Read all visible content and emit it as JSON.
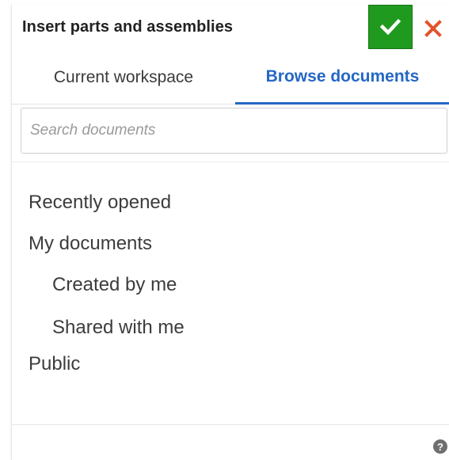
{
  "dialog": {
    "title": "Insert parts and assemblies",
    "accept_icon": "check-icon",
    "cancel_icon": "close-icon",
    "accept_color": "#1f9a1f",
    "cancel_color": "#e4532a"
  },
  "tabs": [
    {
      "label": "Current workspace",
      "active": false
    },
    {
      "label": "Browse documents",
      "active": true
    }
  ],
  "active_tab_color": "#2568c4",
  "search": {
    "value": "",
    "placeholder": "Search documents"
  },
  "nav": {
    "items": [
      {
        "label": "Recently opened",
        "level": 0
      },
      {
        "label": "My documents",
        "level": 0
      },
      {
        "label": "Created by me",
        "level": 1
      },
      {
        "label": "Shared with me",
        "level": 1
      },
      {
        "label": "Public",
        "level": 0
      }
    ]
  },
  "footer": {
    "help_icon": "help-icon",
    "help_glyph": "?"
  }
}
